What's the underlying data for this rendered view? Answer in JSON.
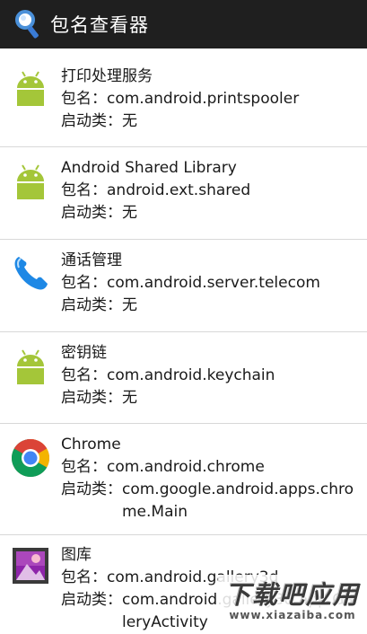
{
  "app": {
    "title": "包名查看器"
  },
  "labels": {
    "package": "包名：",
    "launcher": "启动类："
  },
  "items": [
    {
      "name": "打印处理服务",
      "package": "com.android.printspooler",
      "launcher": "无",
      "icon": "android-robot-icon"
    },
    {
      "name": "Android Shared Library",
      "package": "android.ext.shared",
      "launcher": "无",
      "icon": "android-robot-icon"
    },
    {
      "name": "通话管理",
      "package": "com.android.server.telecom",
      "launcher": "无",
      "icon": "phone-handset-icon"
    },
    {
      "name": "密钥链",
      "package": "com.android.keychain",
      "launcher": "无",
      "icon": "android-robot-icon"
    },
    {
      "name": "Chrome",
      "package": "com.android.chrome",
      "launcher": "com.google.android.apps.chrome.Main",
      "icon": "chrome-icon"
    },
    {
      "name": "图库",
      "package": "com.android.gallery3d",
      "launcher": "com.android.gallery3d.app.GalleryActivity",
      "icon": "gallery-icon"
    }
  ],
  "watermark": {
    "big": "下载吧应用",
    "small": "www.xiazaiba.com"
  },
  "colors": {
    "titlebar": "#1f1f1f",
    "android_green": "#a4c639",
    "divider": "#d8d8d8"
  }
}
